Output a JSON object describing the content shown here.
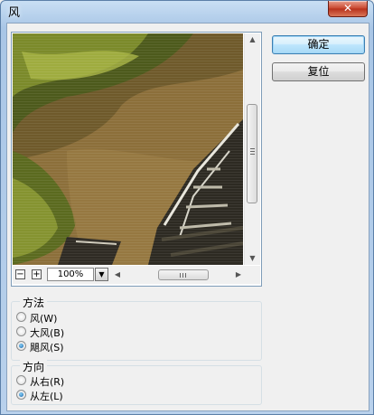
{
  "window": {
    "title": "风",
    "close_symbol": "✕"
  },
  "preview": {
    "zoom_out_symbol": "−",
    "zoom_in_symbol": "+",
    "zoom_value": "100%"
  },
  "buttons": {
    "ok": "确定",
    "reset": "复位"
  },
  "method": {
    "title": "方法",
    "options": [
      "风(W)",
      "大风(B)",
      "飓风(S)"
    ],
    "selected": 2
  },
  "direction": {
    "title": "方向",
    "options": [
      "从右(R)",
      "从左(L)"
    ],
    "selected": 1
  }
}
